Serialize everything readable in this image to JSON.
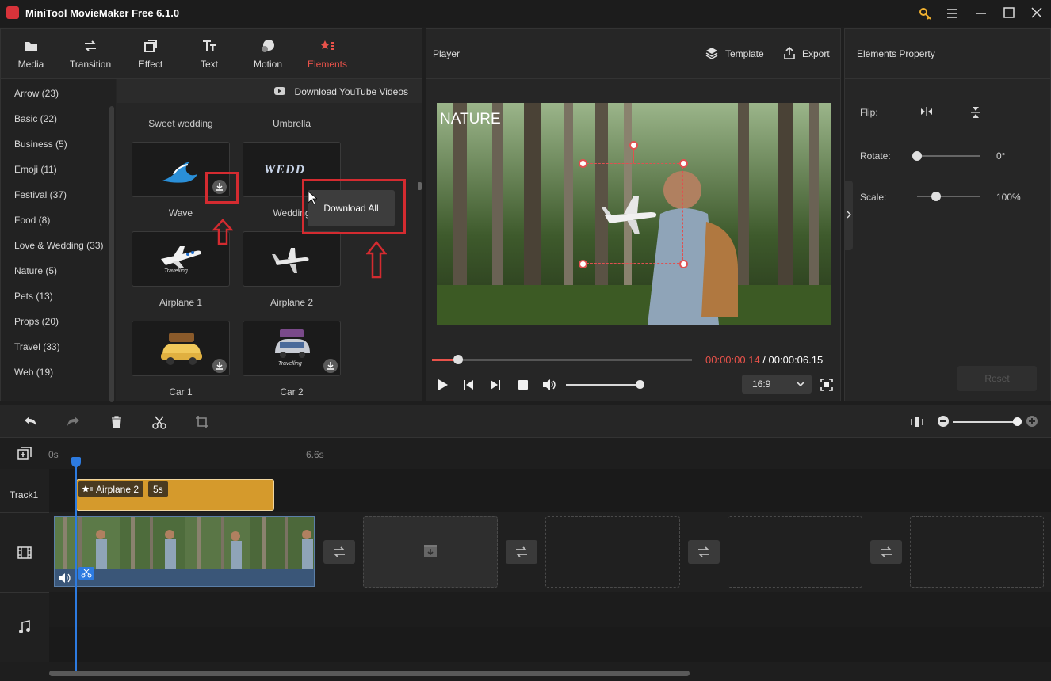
{
  "window": {
    "title": "MiniTool MovieMaker Free 6.1.0"
  },
  "toolbar": {
    "tabs": [
      {
        "label": "Media",
        "icon": "folder-icon"
      },
      {
        "label": "Transition",
        "icon": "transition-icon"
      },
      {
        "label": "Effect",
        "icon": "effect-icon"
      },
      {
        "label": "Text",
        "icon": "text-icon"
      },
      {
        "label": "Motion",
        "icon": "motion-icon"
      },
      {
        "label": "Elements",
        "icon": "elements-icon",
        "active": true
      }
    ]
  },
  "categories": [
    "Arrow (23)",
    "Basic (22)",
    "Business (5)",
    "Emoji (11)",
    "Festival (37)",
    "Food (8)",
    "Love & Wedding (33)",
    "Nature (5)",
    "Pets (13)",
    "Props (20)",
    "Travel (33)",
    "Web (19)"
  ],
  "elements_panel": {
    "youtube_label": "Download YouTube Videos",
    "items": [
      {
        "label": "Sweet wedding"
      },
      {
        "label": "Umbrella"
      },
      {
        "label": "Wave",
        "icon": "wave-icon"
      },
      {
        "label": "Wedding",
        "icon": "wedding-text-icon"
      },
      {
        "label": "Airplane 1",
        "icon": "airplane-icon"
      },
      {
        "label": "Airplane 2",
        "icon": "airplane-icon"
      },
      {
        "label": "Car 1",
        "icon": "car-icon"
      },
      {
        "label": "Car 2",
        "icon": "car-icon"
      }
    ],
    "thumbnail_text": {
      "wedding": "WEDD",
      "travelling": "Travelling"
    },
    "download_all_label": "Download All"
  },
  "player": {
    "title": "Player",
    "template_label": "Template",
    "export_label": "Export",
    "overlay_text": "NATURE",
    "time_current": "00:00:00.14",
    "time_separator": " / ",
    "time_total": "00:00:06.15",
    "aspect_ratio": "16:9",
    "progress_fraction": 0.1,
    "volume_fraction": 0.98
  },
  "properties": {
    "title": "Elements Property",
    "flip_label": "Flip:",
    "rotate_label": "Rotate:",
    "rotate_value": "0°",
    "rotate_fraction": 0,
    "scale_label": "Scale:",
    "scale_value": "100%",
    "scale_fraction": 0.3,
    "reset_label": "Reset"
  },
  "timeline": {
    "ruler": [
      "0s",
      "6.6s"
    ],
    "track1_label": "Track1",
    "element_clip": {
      "name": "Airplane 2",
      "duration": "5s"
    },
    "zoom_fraction": 1.0
  },
  "colors": {
    "accent": "#e8524a",
    "highlight_box": "#d42b30",
    "playhead": "#2d7be0",
    "element_clip": "#d59a2c"
  }
}
